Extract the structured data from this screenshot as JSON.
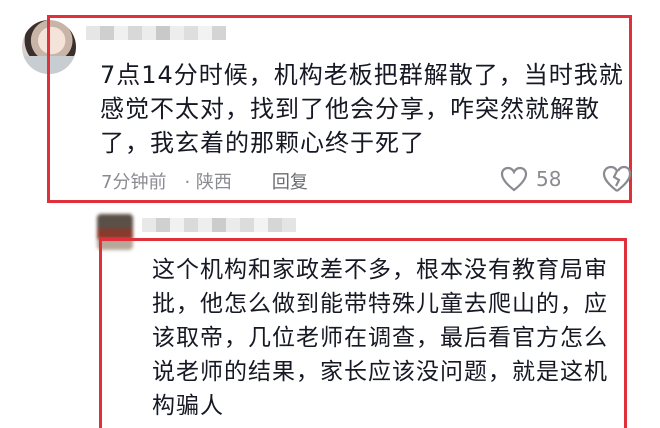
{
  "comments": [
    {
      "text": "7点14分时候，机构老板把群解散了，当时我就感觉不太对，找到了他会分享，咋突然就解散了，我玄着的那颗心终于死了",
      "time": "7分钟前",
      "location": "陕西",
      "reply_label": "回复",
      "likes": "58",
      "highlight_color": "#e0303b"
    },
    {
      "text": "这个机构和家政差不多，根本没有教育局审批，他怎么做到能带特殊儿童去爬山的，应该取帝，几位老师在调查，最后看官方怎么说老师的结果，家长应该没问题，就是这机构骗人",
      "highlight_color": "#e0303b"
    }
  ],
  "icons": [
    "heart-icon",
    "broken-heart-icon"
  ]
}
